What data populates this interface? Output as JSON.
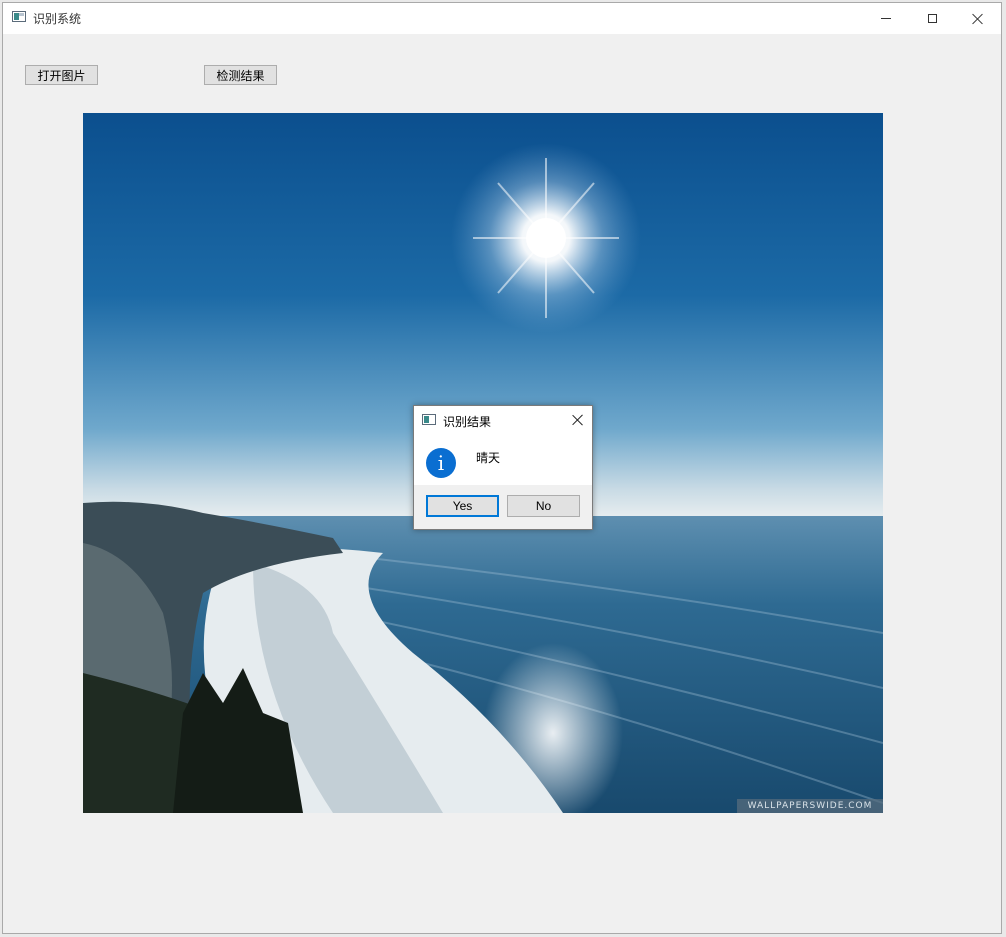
{
  "window": {
    "title": "识别系统",
    "icon": "app-window-icon"
  },
  "toolbar": {
    "open_image_label": "打开图片",
    "detect_label": "检测结果"
  },
  "image": {
    "watermark": "WALLPAPERSWIDE.COM"
  },
  "dialog": {
    "title": "识别结果",
    "message": "晴天",
    "info_glyph": "i",
    "yes_label": "Yes",
    "no_label": "No"
  },
  "colors": {
    "accent": "#0078d7",
    "info_icon": "#0a6ed1"
  }
}
